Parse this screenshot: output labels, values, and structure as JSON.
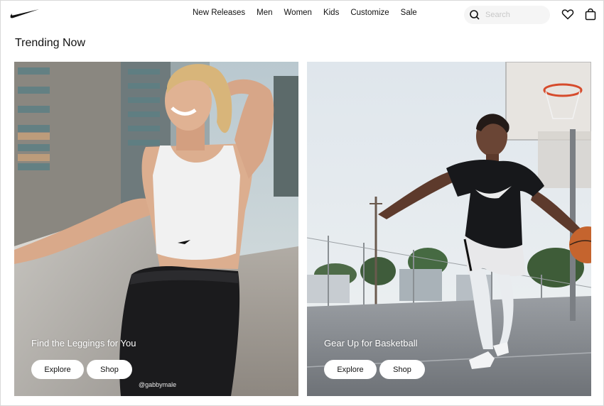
{
  "nav": {
    "logo": "nike-swoosh-logo",
    "links": [
      "New Releases",
      "Men",
      "Women",
      "Kids",
      "Customize",
      "Sale"
    ],
    "search_placeholder": "Search",
    "icons": [
      "search-icon",
      "heart-icon",
      "bag-icon"
    ]
  },
  "section": {
    "title": "Trending Now"
  },
  "cards": [
    {
      "title": "Find the Leggings for You",
      "explore_label": "Explore",
      "shop_label": "Shop",
      "credit": "@gabbymale"
    },
    {
      "title": "Gear Up for Basketball",
      "explore_label": "Explore",
      "shop_label": "Shop"
    }
  ]
}
